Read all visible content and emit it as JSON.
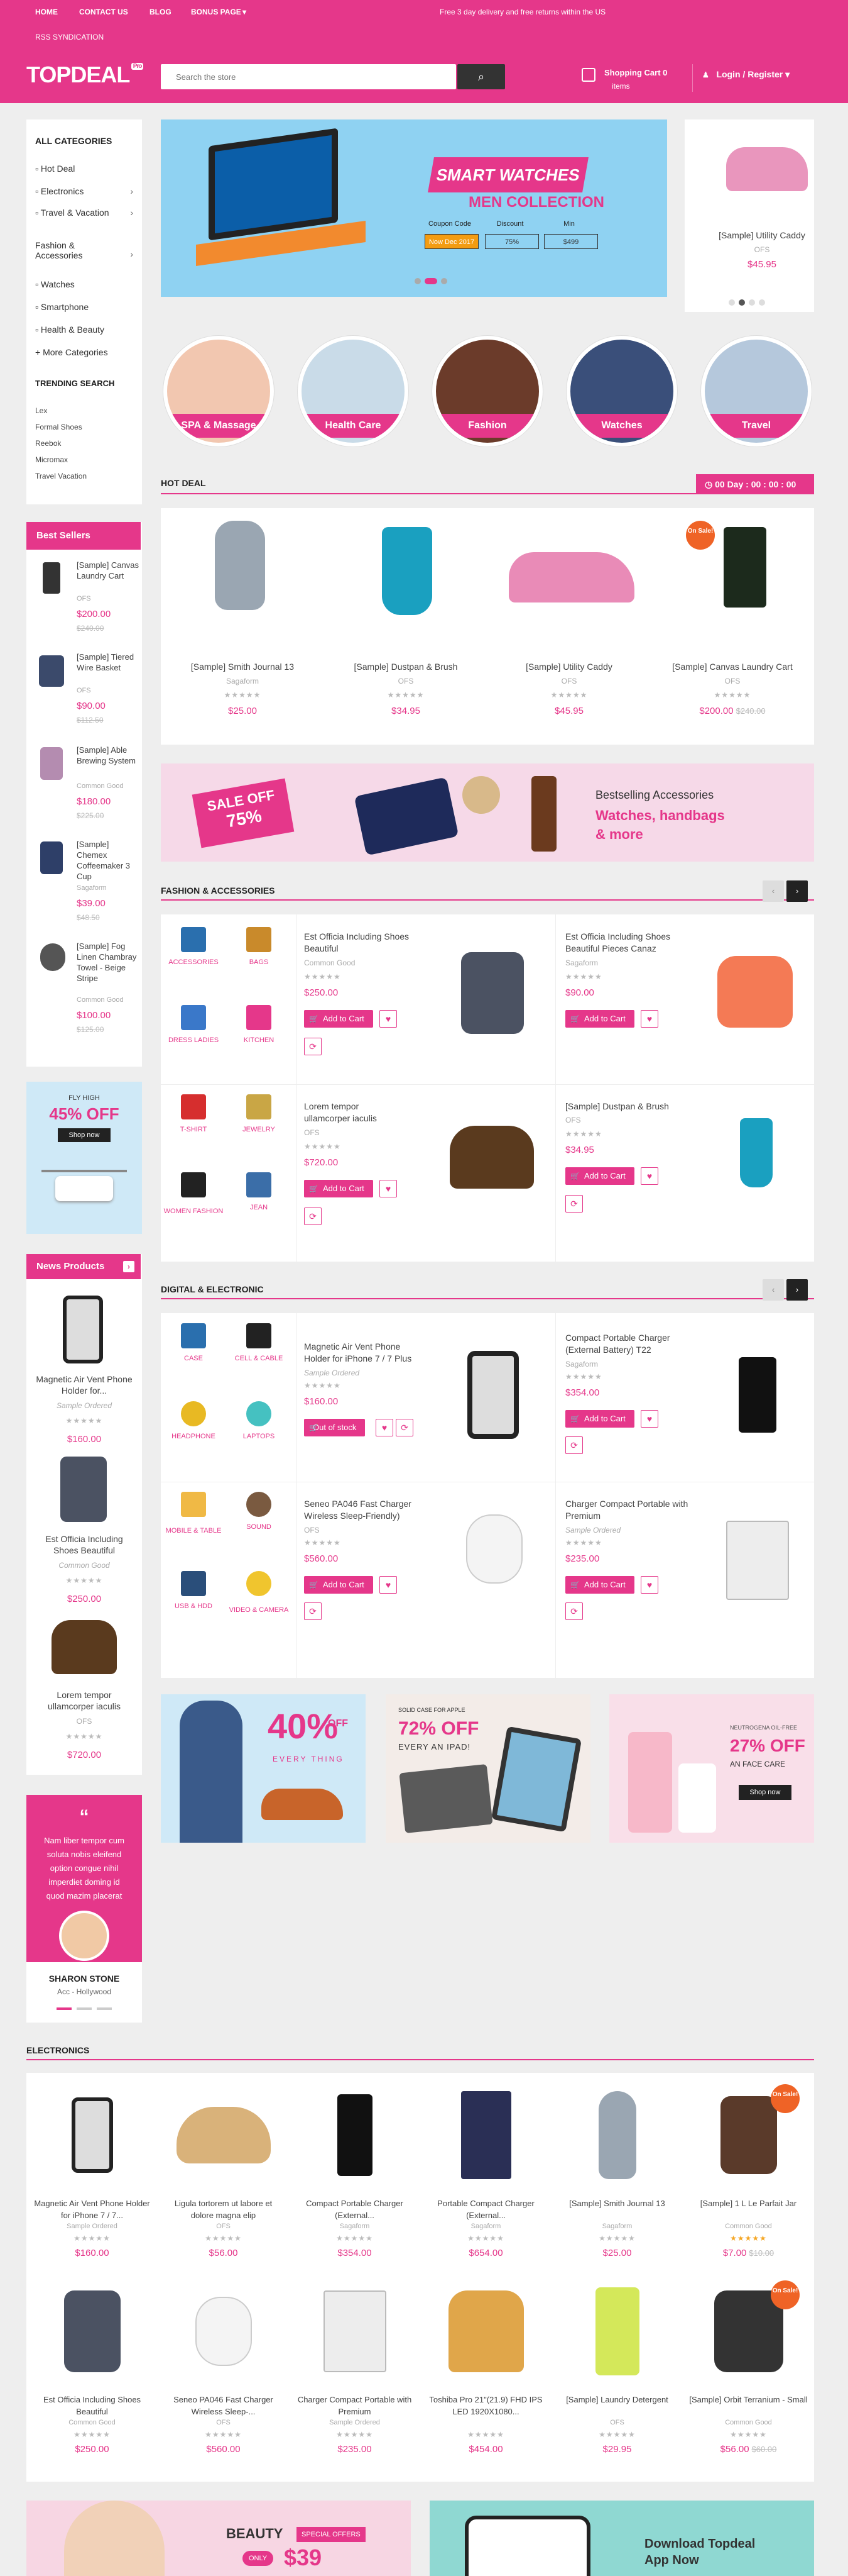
{
  "topbar": {
    "links": [
      "HOME",
      "CONTACT US",
      "BLOG",
      "BONUS PAGE"
    ],
    "rss": "RSS SYNDICATION",
    "promo": "Free 3 day delivery and free returns within the US"
  },
  "header": {
    "logo": "TOPDEAL",
    "logo_sub": "Pro",
    "search_placeholder": "Search the store",
    "cart_title": "Shopping Cart 0",
    "cart_items": "items",
    "login": "Login / Register"
  },
  "sidebar": {
    "categories_title": "ALL CATEGORIES",
    "categories": [
      "Hot Deal",
      "Electronics",
      "Travel & Vacation",
      "Fashion &",
      "Accessories",
      "Watches",
      "Smartphone",
      "Health & Beauty",
      "More Categories"
    ],
    "trending_title": "TRENDING SEARCH",
    "trending": [
      "Lex",
      "Formal Shoes",
      "Reebok",
      "Micromax",
      "Travel Vacation"
    ],
    "best_sellers_title": "Best Sellers",
    "best_sellers": [
      {
        "name": "[Sample] Canvas Laundry Cart",
        "brand": "OFS",
        "price": "$200.00",
        "old": "$240.00"
      },
      {
        "name": "[Sample] Tiered Wire Basket",
        "brand": "OFS",
        "price": "$90.00",
        "old": "$112.50"
      },
      {
        "name": "[Sample] Able Brewing System",
        "brand": "Common Good",
        "price": "$180.00",
        "old": "$225.00"
      },
      {
        "name": "[Sample] Chemex Coffeemaker 3 Cup",
        "brand": "Sagaform",
        "price": "$39.00",
        "old": "$48.50"
      },
      {
        "name": "[Sample] Fog Linen Chambray Towel - Beige Stripe",
        "brand": "Common Good",
        "price": "$100.00",
        "old": "$125.00"
      }
    ],
    "drone_promo": {
      "line1": "FLY HIGH",
      "line2": "45% OFF",
      "cta": "Shop now"
    },
    "news_title": "News Products",
    "news_products": [
      {
        "name": "Magnetic Air Vent Phone Holder for...",
        "brand": "Sample Ordered",
        "price": "$160.00"
      },
      {
        "name": "Est Officia Including Shoes Beautiful",
        "brand": "Common Good",
        "price": "$250.00"
      },
      {
        "name": "Lorem tempor ullamcorper iaculis",
        "brand": "OFS",
        "price": "$720.00"
      }
    ],
    "testimonial": {
      "quote": "Nam liber tempor cum soluta nobis eleifend option congue nihil imperdiet doming id quod mazim placerat",
      "name": "SHARON STONE",
      "role": "Acc - Hollywood"
    }
  },
  "hero": {
    "title": "SMART WATCHES",
    "subtitle": "MEN COLLECTION",
    "coupon_headers": [
      "Coupon Code",
      "Discount",
      "Min"
    ],
    "coupon_values": [
      "Now Dec 2017",
      "75%",
      "$499"
    ]
  },
  "side_product": {
    "name": "[Sample] Utility Caddy",
    "brand": "OFS",
    "price": "$45.95"
  },
  "circle_categories": [
    "SPA & Massage",
    "Health Care",
    "Fashion",
    "Watches",
    "Travel"
  ],
  "hot_deal": {
    "title": "HOT DEAL",
    "timer": "00 Day : 00 : 00 : 00",
    "products": [
      {
        "name": "[Sample] Smith Journal 13",
        "brand": "Sagaform",
        "price": "$25.00",
        "old": ""
      },
      {
        "name": "[Sample] Dustpan & Brush",
        "brand": "OFS",
        "price": "$34.95",
        "old": ""
      },
      {
        "name": "[Sample] Utility Caddy",
        "brand": "OFS",
        "price": "$45.95",
        "old": ""
      },
      {
        "name": "[Sample] Canvas Laundry Cart",
        "brand": "OFS",
        "price": "$200.00",
        "old": "$240.00"
      }
    ],
    "sale_badge": "On Sale!"
  },
  "accessories_banner": {
    "ribbon1": "SALE OFF",
    "ribbon2": "75%",
    "line1": "Bestselling Accessories",
    "line2": "Watches, handbags",
    "line3": "& more"
  },
  "fashion": {
    "title": "FASHION & ACCESSORIES",
    "cats": [
      "ACCESSORIES",
      "BAGS",
      "DRESS LADIES",
      "KITCHEN",
      "T-SHIRT",
      "JEWELRY",
      "WOMEN FASHION",
      "JEAN"
    ],
    "products": [
      {
        "name": "Est Officia Including Shoes Beautiful",
        "brand": "Common Good",
        "price": "$250.00"
      },
      {
        "name": "Est Officia Including Shoes Beautiful Pieces Canaz",
        "brand": "Sagaform",
        "price": "$90.00"
      },
      {
        "name": "Lorem tempor ullamcorper iaculis",
        "brand": "OFS",
        "price": "$720.00"
      },
      {
        "name": "[Sample] Dustpan & Brush",
        "brand": "OFS",
        "price": "$34.95"
      }
    ],
    "add_to_cart": "Add to Cart"
  },
  "digital": {
    "title": "DIGITAL & ELECTRONIC",
    "cats": [
      "CASE",
      "CELL & CABLE",
      "HEADPHONE",
      "LAPTOPS",
      "MOBILE & TABLE",
      "SOUND",
      "USB & HDD",
      "VIDEO & CAMERA"
    ],
    "products": [
      {
        "name": "Magnetic Air Vent Phone Holder for iPhone 7 / 7 Plus",
        "brand": "Sample Ordered",
        "price": "$160.00",
        "btn": "Out of stock"
      },
      {
        "name": "Compact Portable Charger (External Battery) T22",
        "brand": "Sagaform",
        "price": "$354.00",
        "btn": "Add to Cart"
      },
      {
        "name": "Seneo PA046 Fast Charger Wireless Sleep-Friendly)",
        "brand": "OFS",
        "price": "$560.00",
        "btn": "Add to Cart"
      },
      {
        "name": "Charger Compact Portable with Premium",
        "brand": "Sample Ordered",
        "price": "$235.00",
        "btn": "Add to Cart"
      }
    ]
  },
  "promos": [
    {
      "line1": "40%",
      "line2": "OFF",
      "line3": "EVERY THING"
    },
    {
      "line1": "SOLID CASE FOR APPLE",
      "line2": "72% OFF",
      "line3": "EVERY AN IPAD!"
    },
    {
      "line1": "NEUTROGENA OIL-FREE",
      "line2": "27% OFF",
      "line3": "AN FACE CARE",
      "cta": "Shop now"
    }
  ],
  "electronics": {
    "title": "ELECTRONICS",
    "products": [
      {
        "name": "Magnetic Air Vent Phone Holder for iPhone 7 / 7...",
        "brand": "Sample Ordered",
        "price": "$160.00",
        "old": ""
      },
      {
        "name": "Ligula tortorem ut labore et dolore magna elip",
        "brand": "OFS",
        "price": "$56.00",
        "old": ""
      },
      {
        "name": "Compact Portable Charger (External...",
        "brand": "Sagaform",
        "price": "$354.00",
        "old": ""
      },
      {
        "name": "Portable Compact Charger (External...",
        "brand": "Sagaform",
        "price": "$654.00",
        "old": ""
      },
      {
        "name": "[Sample] Smith Journal 13",
        "brand": "Sagaform",
        "price": "$25.00",
        "old": ""
      },
      {
        "name": "[Sample] 1 L Le Parfait Jar",
        "brand": "Common Good",
        "price": "$7.00",
        "old": "$10.00"
      },
      {
        "name": "Est Officia Including Shoes Beautiful",
        "brand": "Common Good",
        "price": "$250.00",
        "old": ""
      },
      {
        "name": "Seneo PA046 Fast Charger Wireless Sleep-...",
        "brand": "OFS",
        "price": "$560.00",
        "old": ""
      },
      {
        "name": "Charger Compact Portable with Premium",
        "brand": "Sample Ordered",
        "price": "$235.00",
        "old": ""
      },
      {
        "name": "Toshiba Pro 21\"(21.9) FHD IPS LED 1920X1080...",
        "brand": "",
        "price": "$454.00",
        "old": ""
      },
      {
        "name": "[Sample] Laundry Detergent",
        "brand": "OFS",
        "price": "$29.95",
        "old": ""
      },
      {
        "name": "[Sample] Orbit Terranium - Small",
        "brand": "Common Good",
        "price": "$56.00",
        "old": "$60.00"
      }
    ]
  },
  "bottom_banners": {
    "beauty": "BEAUTY",
    "special": "SPECIAL OFFERS",
    "only": "ONLY",
    "price": "$39",
    "app1": "Download Topdeal",
    "app2": "App Now"
  },
  "colors": {
    "accent": "#e5378a",
    "dark": "#333333"
  }
}
